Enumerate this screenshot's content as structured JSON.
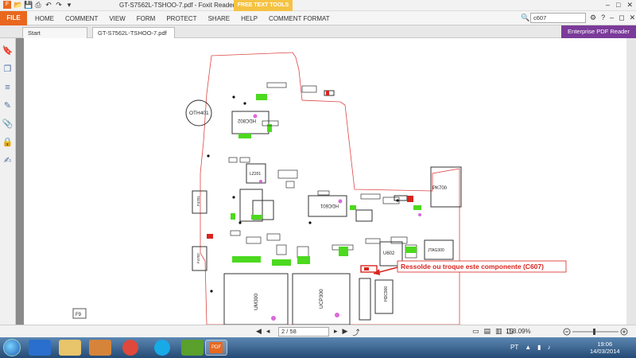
{
  "window": {
    "title": "GT-S7562L-TSHOO-7.pdf - Foxit Reader",
    "free_text_tools": "FREE TEXT TOOLS"
  },
  "ribbon": {
    "file": "FILE",
    "tabs": [
      "HOME",
      "COMMENT",
      "VIEW",
      "FORM",
      "PROTECT",
      "SHARE",
      "HELP",
      "COMMENT FORMAT"
    ],
    "search_value": "c607"
  },
  "doc_tabs": [
    {
      "label": "Start"
    },
    {
      "label": "GT-S7562L-TSHOO-7.pdf *"
    }
  ],
  "enterprise_banner": "Enterprise PDF Reader",
  "schematic": {
    "labels": [
      "OTH401",
      "HDC802",
      "HDC601",
      "LZ201",
      "PK700",
      "U602",
      "UM300",
      "UCP300",
      "JTAG300",
      "F4701",
      "F4702",
      "HDC900",
      "U002",
      "C607",
      "F9"
    ],
    "annotation": "Ressolde ou troque este componente (C607)"
  },
  "nav": {
    "page_value": "2 / 58",
    "zoom": "158.09%"
  },
  "taskbar": {
    "lang": "PT",
    "time": "19:06",
    "date": "14/03/2014"
  },
  "colors": {
    "file_tab": "#e9681e",
    "enterprise": "#7b3a9a",
    "annotation": "#d8241f",
    "component_green": "#4cd91f",
    "pad_magenta": "#d96ad9"
  }
}
